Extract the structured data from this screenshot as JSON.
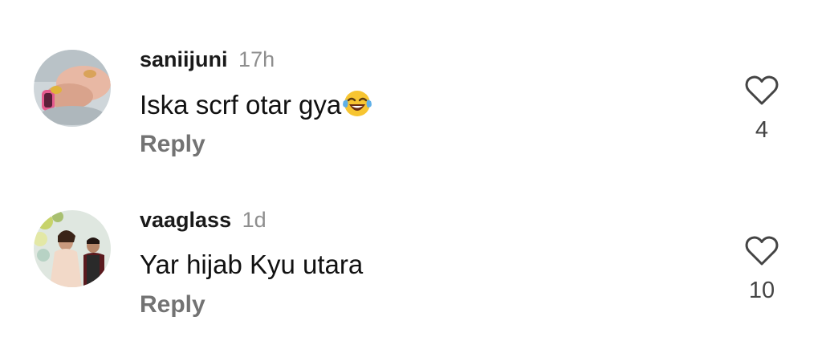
{
  "comments": [
    {
      "username": "saniijuni",
      "timestamp": "17h",
      "text": "Iska scrf otar gya",
      "emoji": "face-with-tears-of-joy-icon",
      "reply_label": "Reply",
      "like_count": "4",
      "like_icon": "heart-outline-icon"
    },
    {
      "username": "vaaglass",
      "timestamp": "1d",
      "text": "Yar hijab Kyu utara",
      "reply_label": "Reply",
      "like_count": "10",
      "like_icon": "heart-outline-icon"
    }
  ],
  "colors": {
    "text": "#111111",
    "muted": "#8e8e8e",
    "reply": "#737373",
    "icon": "#444444"
  }
}
